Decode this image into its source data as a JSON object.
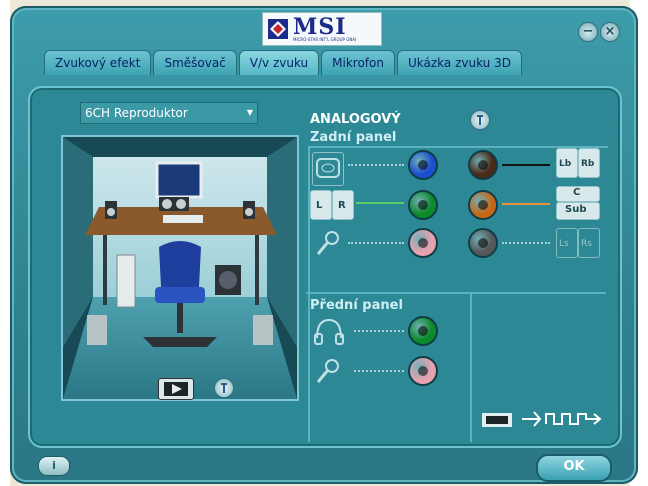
{
  "window": {
    "brand": "MSI",
    "brand_sub": "MICRO-STAR INT'L GROUP GNAI",
    "minimize_label": "−",
    "close_label": "×"
  },
  "tabs": [
    {
      "label": "Zvukový efekt"
    },
    {
      "label": "Směšovač"
    },
    {
      "label": "V/v zvuku"
    },
    {
      "label": "Mikrofon"
    },
    {
      "label": "Ukázka zvuku 3D"
    }
  ],
  "active_tab": "V/v zvuku",
  "speaker_select": {
    "value": "6CH Reproduktor"
  },
  "analog": {
    "title": "ANALOGOVÝ",
    "rear_panel_label": "Zadní panel",
    "front_panel_label": "Přední panel",
    "rear_left_labels": {
      "l": "L",
      "r": "R"
    },
    "rear_right_labels": {
      "rb_1": "Lb",
      "rb_2": "Rb",
      "center": "C",
      "sub": "Sub",
      "side_1": "Ls",
      "side_2": "Rs"
    },
    "jack_colors": {
      "blue": "#1b4fd0",
      "green": "#0c8a2a",
      "pink": "#e7a1b0",
      "brown": "#4b2a17",
      "orange": "#c76716",
      "gray": "#55575a"
    }
  },
  "footer": {
    "ok_label": "OK",
    "info_label": "i"
  }
}
